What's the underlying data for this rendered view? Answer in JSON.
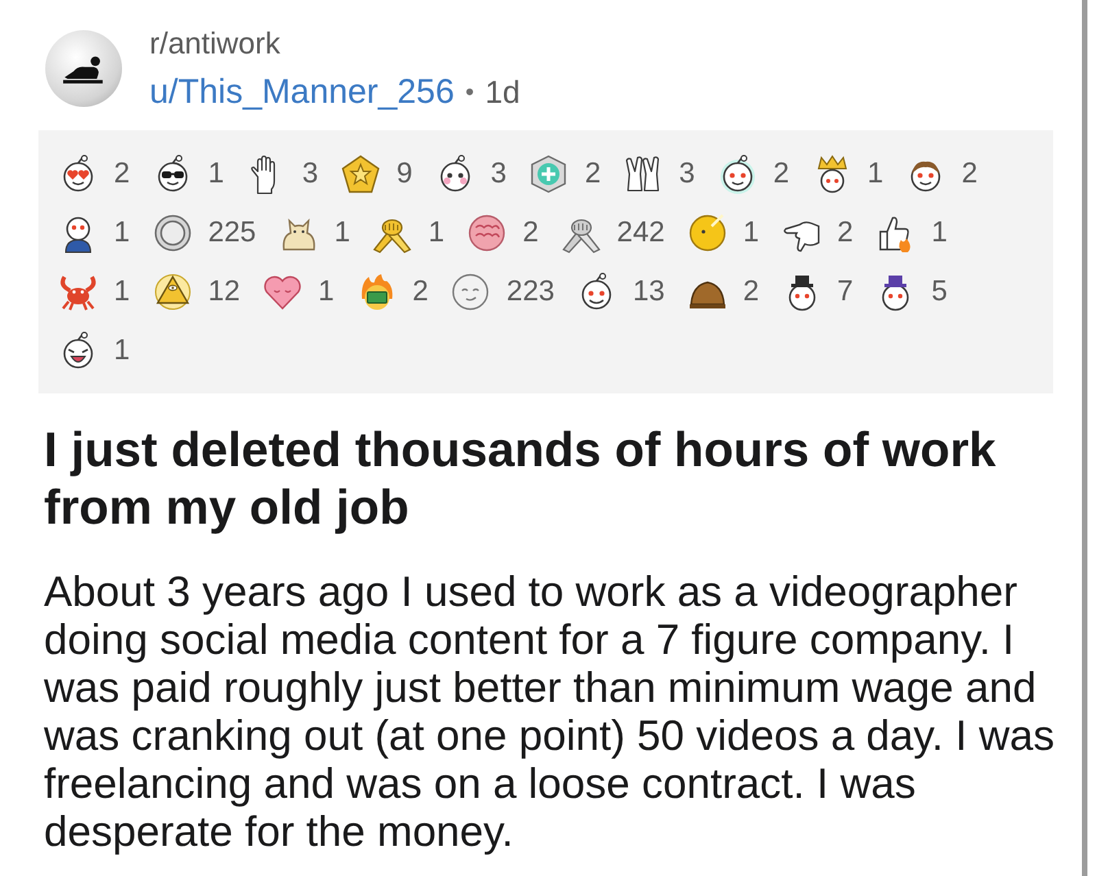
{
  "post": {
    "subreddit": "r/antiwork",
    "author": "u/This_Manner_256",
    "separator": "•",
    "age": "1d"
  },
  "award_rows": [
    [
      {
        "count": "2"
      },
      {
        "count": "1"
      },
      {
        "count": "3"
      },
      {
        "count": "9"
      },
      {
        "count": "3"
      },
      {
        "count": "2"
      },
      {
        "count": "3"
      },
      {
        "count": "2"
      },
      {
        "count": "1"
      },
      {
        "count": "2"
      }
    ],
    [
      {
        "count": "1"
      },
      {
        "count": "225"
      },
      {
        "count": "1"
      },
      {
        "count": "1"
      },
      {
        "count": "2"
      },
      {
        "count": "242"
      },
      {
        "count": "1"
      },
      {
        "count": "2"
      },
      {
        "count": "1"
      }
    ],
    [
      {
        "count": "1"
      },
      {
        "count": "12"
      },
      {
        "count": "1"
      },
      {
        "count": "2"
      },
      {
        "count": "223"
      },
      {
        "count": "13"
      },
      {
        "count": "2"
      },
      {
        "count": "7"
      },
      {
        "count": "5"
      }
    ],
    [
      {
        "count": "1"
      }
    ]
  ],
  "title": "I just deleted thousands of hours of work from my old job",
  "body": "About 3 years ago I used to work as a videographer doing social media content for a 7 figure company. I was paid roughly just better than minimum wage and was cranking out (at one point) 50 videos a day. I was freelancing and was on a loose contract. I was desperate for the money."
}
